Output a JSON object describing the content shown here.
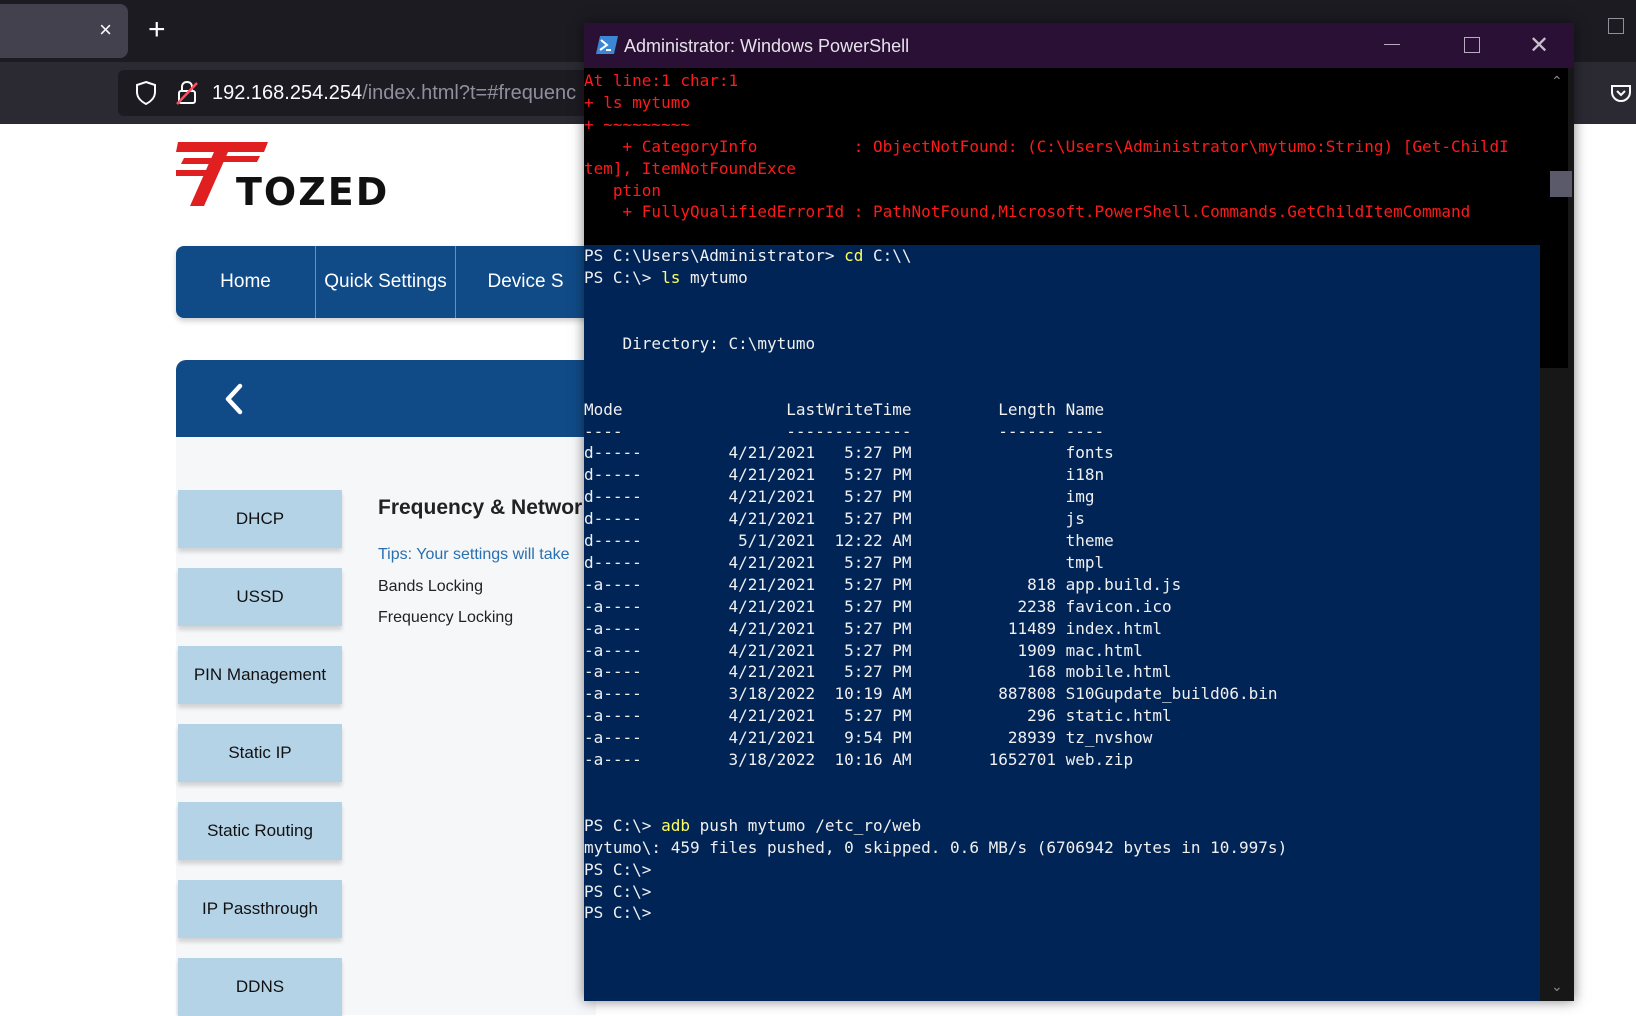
{
  "browser": {
    "new_tab": "+",
    "tab_close": "×",
    "url_host": "192.168.254.254",
    "url_path": "/index.html?t=#frequenc"
  },
  "router": {
    "logo_text": "TOZED",
    "nav": [
      "Home",
      "Quick Settings",
      "Device S"
    ],
    "sidebar": [
      "DHCP",
      "USSD",
      "PIN Management",
      "Static IP",
      "Static Routing",
      "IP Passthrough",
      "DDNS"
    ],
    "section_title": "Frequency & Networ",
    "tips": "Tips: Your settings will take",
    "links": [
      "Bands Locking",
      "Frequency Locking"
    ]
  },
  "powershell": {
    "title": "Administrator: Windows PowerShell",
    "error_lines": [
      "At line:1 char:1",
      "+ ls mytumo",
      "+ ~~~~~~~~~",
      "    + CategoryInfo          : ObjectNotFound: (C:\\Users\\Administrator\\mytumo:String) [Get-ChildI",
      "tem], ItemNotFoundExce",
      "   ption",
      "    + FullyQualifiedErrorId : PathNotFound,Microsoft.PowerShell.Commands.GetChildItemCommand"
    ],
    "cmd1_prompt": "PS C:\\Users\\Administrator> ",
    "cmd1_name": "cd",
    "cmd1_arg": " C:\\\\",
    "cmd2_prompt": "PS C:\\> ",
    "cmd2_name": "ls",
    "cmd2_arg": " mytumo",
    "directory": "    Directory: C:\\mytumo",
    "header": "Mode                 LastWriteTime         Length Name",
    "header_rule": "----                 -------------         ------ ----",
    "rows": [
      "d-----         4/21/2021   5:27 PM                fonts",
      "d-----         4/21/2021   5:27 PM                i18n",
      "d-----         4/21/2021   5:27 PM                img",
      "d-----         4/21/2021   5:27 PM                js",
      "d-----          5/1/2021  12:22 AM                theme",
      "d-----         4/21/2021   5:27 PM                tmpl",
      "-a----         4/21/2021   5:27 PM            818 app.build.js",
      "-a----         4/21/2021   5:27 PM           2238 favicon.ico",
      "-a----         4/21/2021   5:27 PM          11489 index.html",
      "-a----         4/21/2021   5:27 PM           1909 mac.html",
      "-a----         4/21/2021   5:27 PM            168 mobile.html",
      "-a----         3/18/2022  10:19 AM         887808 S10Gupdate_build06.bin",
      "-a----         4/21/2021   5:27 PM            296 static.html",
      "-a----         4/21/2021   9:54 PM          28939 tz_nvshow",
      "-a----         3/18/2022  10:16 AM        1652701 web.zip"
    ],
    "cmd3_prompt": "PS C:\\> ",
    "cmd3_name": "adb",
    "cmd3_arg": " push mytumo /etc_ro/web",
    "push_result": "mytumo\\: 459 files pushed, 0 skipped. 0.6 MB/s (6706942 bytes in 10.997s)",
    "trailing_prompts": [
      "PS C:\\>",
      "PS C:\\>",
      "PS C:\\>"
    ]
  }
}
